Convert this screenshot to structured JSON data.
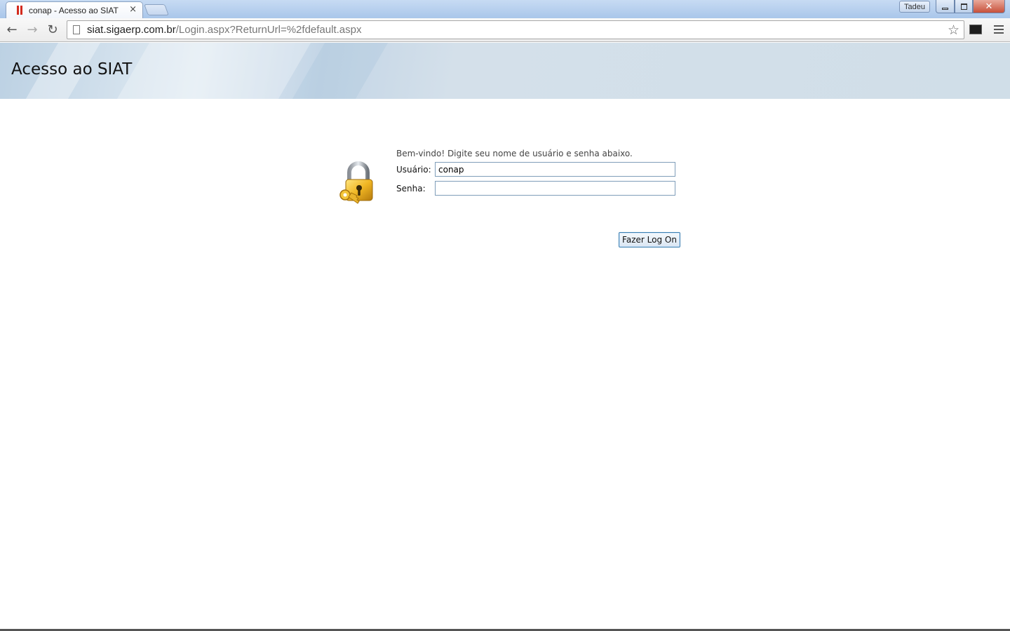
{
  "browser": {
    "tab": {
      "title": "conap - Acesso ao SIAT",
      "close_glyph": "×",
      "favicon": "siat-favicon-icon"
    },
    "profile_label": "Tadeu",
    "window_controls": {
      "close_glyph": "✕"
    },
    "nav": {
      "back_glyph": "←",
      "forward_glyph": "→",
      "reload_glyph": "↻"
    },
    "address_bar": {
      "host": "siat.sigaerp.com.br",
      "path": "/Login.aspx?ReturnUrl=%2fdefault.aspx"
    },
    "bookmark_glyph": "☆"
  },
  "page": {
    "header_title": "Acesso ao SIAT",
    "login": {
      "welcome_text": "Bem-vindo! Digite seu nome de usuário e senha abaixo.",
      "username_label": "Usuário:",
      "username_value": "conap",
      "password_label": "Senha:",
      "password_value": "",
      "submit_label": "Fazer Log On"
    }
  },
  "colors": {
    "header_band": "#d0dee8",
    "input_border": "#7f9db9",
    "button_border": "#3c7fb1",
    "favicon_red": "#d32b1f"
  }
}
